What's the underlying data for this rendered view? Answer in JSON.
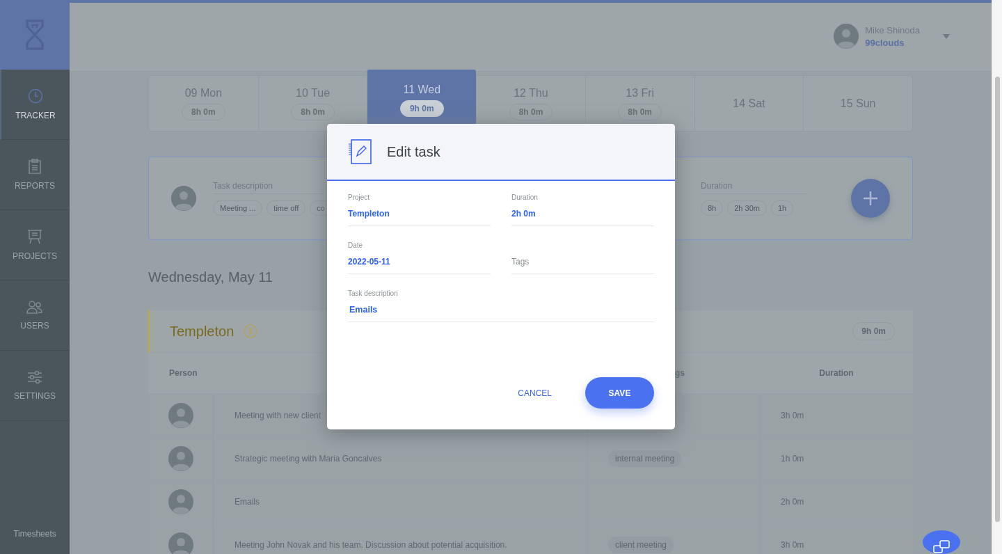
{
  "sidebar": {
    "nav": [
      {
        "label": "TRACKER",
        "selected": true
      },
      {
        "label": "REPORTS",
        "selected": false
      },
      {
        "label": "PROJECTS",
        "selected": false
      },
      {
        "label": "USERS",
        "selected": false
      },
      {
        "label": "SETTINGS",
        "selected": false
      }
    ],
    "footer": "Timesheets"
  },
  "user": {
    "name": "Mike Shinoda",
    "company": "99clouds"
  },
  "week": [
    {
      "day": "09 Mon",
      "total": "8h 0m",
      "selected": false
    },
    {
      "day": "10 Tue",
      "total": "8h 0m",
      "selected": false
    },
    {
      "day": "11 Wed",
      "total": "9h 0m",
      "selected": true
    },
    {
      "day": "12 Thu",
      "total": "8h 0m",
      "selected": false
    },
    {
      "day": "13 Fri",
      "total": "8h 0m",
      "selected": false
    },
    {
      "day": "14 Sat",
      "selected": false
    },
    {
      "day": "15 Sun",
      "selected": false
    }
  ],
  "quick_entry": {
    "description": {
      "placeholder": "Task description",
      "chips": [
        "Meeting ...",
        "time off",
        "co"
      ]
    },
    "duration": {
      "placeholder": "Duration",
      "chips": [
        "8h",
        "2h 30m",
        "1h"
      ]
    }
  },
  "day_heading": "Wednesday, May 11",
  "project": {
    "name": "Templeton",
    "total": "9h 0m"
  },
  "table": {
    "columns": [
      "Person",
      "gs",
      "Duration"
    ],
    "rows": [
      {
        "description": "Meeting with new client",
        "duration": "3h 0m"
      },
      {
        "description": "Strategic meeting with Maria Goncalves",
        "tag": "internal meeting",
        "duration": "1h 0m"
      },
      {
        "description": "Emails",
        "duration": "2h 0m"
      },
      {
        "description": "Meeting John Novak and his team. Discussion about potential acquisition.",
        "tag": "client meeting",
        "duration": "3h 0m"
      }
    ]
  },
  "dialog": {
    "title": "Edit task",
    "fields": [
      {
        "label": "Project",
        "value": "Templeton"
      },
      {
        "label": "Duration",
        "value": "2h 0m"
      },
      {
        "label": "Date",
        "value": "2022-05-11"
      },
      {
        "placeholder": "Tags"
      }
    ],
    "description": {
      "label": "Task description",
      "value": "Emails"
    },
    "cancel": "CANCEL",
    "save": "SAVE"
  }
}
